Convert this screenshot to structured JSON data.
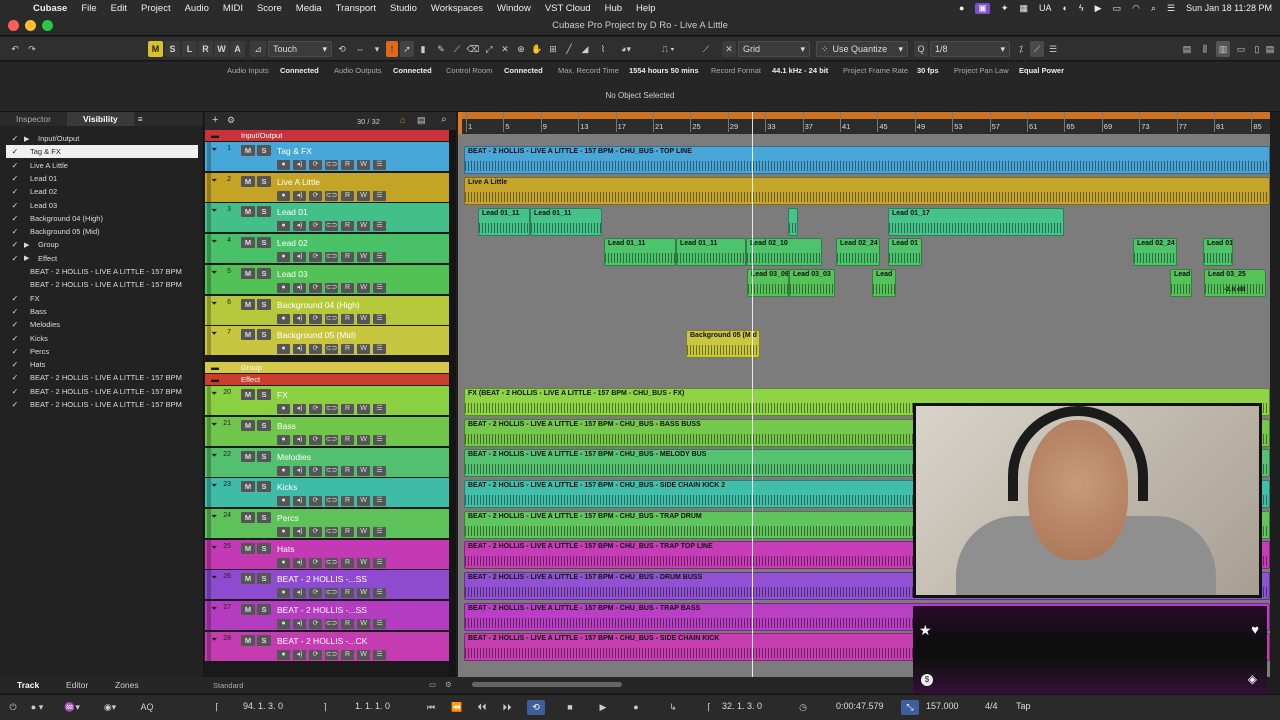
{
  "menubar": {
    "app_name": "Cubase",
    "items": [
      "File",
      "Edit",
      "Project",
      "Audio",
      "MIDI",
      "Score",
      "Media",
      "Transport",
      "Studio",
      "Workspaces",
      "Window",
      "VST Cloud",
      "Hub",
      "Help"
    ],
    "lang": "UA",
    "clock": "Sun Jan 18  11:28 PM"
  },
  "window": {
    "title": "Cubase Pro Project by D Ro - Live A Little"
  },
  "toolbar": {
    "m": "M",
    "s": "S",
    "l": "L",
    "r": "R",
    "w": "W",
    "a": "A",
    "automation_mode": "Touch",
    "snap_type": "Grid",
    "quantize_mode": "Use Quantize",
    "quantize_value": "1/8"
  },
  "statusbar": {
    "audio_inputs_label": "Audio Inputs",
    "audio_inputs_value": "Connected",
    "audio_outputs_label": "Audio Outputs",
    "audio_outputs_value": "Connected",
    "control_room_label": "Control Room",
    "control_room_value": "Connected",
    "max_record_label": "Max. Record Time",
    "max_record_value": "1554 hours 50 mins",
    "record_format_label": "Record Format",
    "record_format_value": "44.1 kHz - 24 bit",
    "frame_rate_label": "Project Frame Rate",
    "frame_rate_value": "30 fps",
    "pan_law_label": "Project Pan Law",
    "pan_law_value": "Equal Power"
  },
  "infoline": {
    "text": "No Object Selected"
  },
  "inspector": {
    "tabs": [
      "Inspector",
      "Visibility"
    ],
    "visibility_items": [
      {
        "label": "Input/Output",
        "checked": true,
        "expand": true
      },
      {
        "label": "Tag & FX",
        "checked": true,
        "selected": true
      },
      {
        "label": "Live A Little",
        "checked": true
      },
      {
        "label": "Lead 01",
        "checked": true
      },
      {
        "label": "Lead 02",
        "checked": true
      },
      {
        "label": "Lead 03",
        "checked": true
      },
      {
        "label": "Background 04 (High)",
        "checked": true
      },
      {
        "label": "Background 05 (Mid)",
        "checked": true
      },
      {
        "label": "Group",
        "checked": true,
        "expand": true
      },
      {
        "label": "Effect",
        "checked": true,
        "expand": true
      },
      {
        "label": "BEAT - 2 HOLLIS - LIVE A LITTLE - 157 BPM",
        "checked": false
      },
      {
        "label": "BEAT - 2 HOLLIS - LIVE A LITTLE - 157 BPM",
        "checked": false
      },
      {
        "label": "FX",
        "checked": true
      },
      {
        "label": "Bass",
        "checked": true
      },
      {
        "label": "Melodies",
        "checked": true
      },
      {
        "label": "Kicks",
        "checked": true
      },
      {
        "label": "Percs",
        "checked": true
      },
      {
        "label": "Hats",
        "checked": true
      },
      {
        "label": "BEAT - 2 HOLLIS - LIVE A LITTLE - 157 BPM",
        "checked": true
      },
      {
        "label": "BEAT - 2 HOLLIS - LIVE A LITTLE - 157 BPM",
        "checked": true
      },
      {
        "label": "BEAT - 2 HOLLIS - LIVE A LITTLE - 157 BPM",
        "checked": true
      }
    ]
  },
  "tracklist": {
    "count": "30 / 32",
    "folders": [
      {
        "label": "Input/Output",
        "color": "#c8323c"
      },
      {
        "label": "Group",
        "color": "#d5c84a"
      },
      {
        "label": "Effect",
        "color": "#cc3d2d"
      }
    ],
    "tracks": [
      {
        "num": "1",
        "name": "Tag & FX",
        "color": "#45a8d8"
      },
      {
        "num": "2",
        "name": "Live A Little",
        "color": "#c4a425"
      },
      {
        "num": "3",
        "name": "Lead 01",
        "color": "#43c08a"
      },
      {
        "num": "4",
        "name": "Lead 02",
        "color": "#49c168"
      },
      {
        "num": "5",
        "name": "Lead 03",
        "color": "#52c156"
      },
      {
        "num": "6",
        "name": "Background 04 (High)",
        "color": "#b6c93a"
      },
      {
        "num": "7",
        "name": "Background 05 (Mid)",
        "color": "#c8c63e"
      },
      {
        "num": "20",
        "name": "FX",
        "color": "#8ad040"
      },
      {
        "num": "21",
        "name": "Bass",
        "color": "#70c64a"
      },
      {
        "num": "22",
        "name": "Melodies",
        "color": "#52c06e"
      },
      {
        "num": "23",
        "name": "Kicks",
        "color": "#3fbca8"
      },
      {
        "num": "24",
        "name": "Percs",
        "color": "#5dc25a"
      },
      {
        "num": "25",
        "name": "Hats",
        "color": "#c43ab5"
      },
      {
        "num": "26",
        "name": "BEAT - 2 HOLLIS -...SS",
        "color": "#8e4bd0"
      },
      {
        "num": "27",
        "name": "BEAT - 2 HOLLIS -...SS",
        "color": "#b43cc0"
      },
      {
        "num": "28",
        "name": "BEAT - 2 HOLLIS -...CK",
        "color": "#c43cb0"
      }
    ],
    "footer": "Standard"
  },
  "ruler": {
    "bars": [
      "1",
      "5",
      "9",
      "13",
      "17",
      "21",
      "25",
      "29",
      "33",
      "37",
      "41",
      "45",
      "49",
      "53",
      "57",
      "61",
      "65",
      "69",
      "73",
      "77",
      "81",
      "85"
    ]
  },
  "events": {
    "tag_fx": "BEAT - 2 HOLLIS - LIVE A LITTLE - 157 BPM  - CHU_BUS - TOP LINE",
    "live": "Live A Little",
    "lead01": [
      "Lead 01_11",
      "Lead 01_11",
      "Lead 01_17"
    ],
    "lead02": [
      "Lead 01_11",
      "Lead 01_11",
      "Lead 02_10",
      "Lead 02_24",
      "Lead 01",
      "Lead 02_24",
      "Lead 01"
    ],
    "lead03": [
      "Lead 03_09",
      "Lead 03_03",
      "Lead",
      "Lead",
      "Lead 03_25"
    ],
    "lead03_gain": "-2.6 dB",
    "bg04": "Background 05 (M d",
    "fx": "FX (BEAT - 2 HOLLIS - LIVE A LITTLE - 157 BPM  - CHU_BUS - FX)",
    "bass": "BEAT - 2 HOLLIS - LIVE A LITTLE - 157 BPM  - CHU_BUS - BASS BUSS",
    "melodies": "BEAT - 2 HOLLIS - LIVE A LITTLE - 157 BPM  - CHU_BUS - MELODY BUS",
    "kicks": "BEAT - 2 HOLLIS - LIVE A LITTLE - 157 BPM  - CHU_BUS - SIDE CHAIN KICK 2",
    "percs": "BEAT - 2 HOLLIS - LIVE A LITTLE - 157 BPM  - CHU_BUS - TRAP DRUM",
    "hats": "BEAT - 2 HOLLIS - LIVE A LITTLE - 157 BPM  - CHU_BUS - TRAP TOP LINE",
    "t26": "BEAT - 2 HOLLIS - LIVE A LITTLE - 157 BPM  - CHU_BUS - DRUM BUSS",
    "t27": "BEAT - 2 HOLLIS - LIVE A LITTLE - 157 BPM  - CHU_BUS - TRAP BASS",
    "t28": "BEAT - 2 HOLLIS - LIVE A LITTLE - 157 BPM  - CHU_BUS - SIDE CHAIN KICK"
  },
  "bottom_tabs": [
    "Track",
    "Editor",
    "Zones"
  ],
  "transport": {
    "left_locator": "94. 1. 3.   0",
    "right_locator": "1. 1. 1.   0",
    "position_bars": "32. 1. 3.   0",
    "position_time": "0:00:47.579",
    "tempo": "157.000",
    "signature": "4/4",
    "tap": "Tap"
  }
}
